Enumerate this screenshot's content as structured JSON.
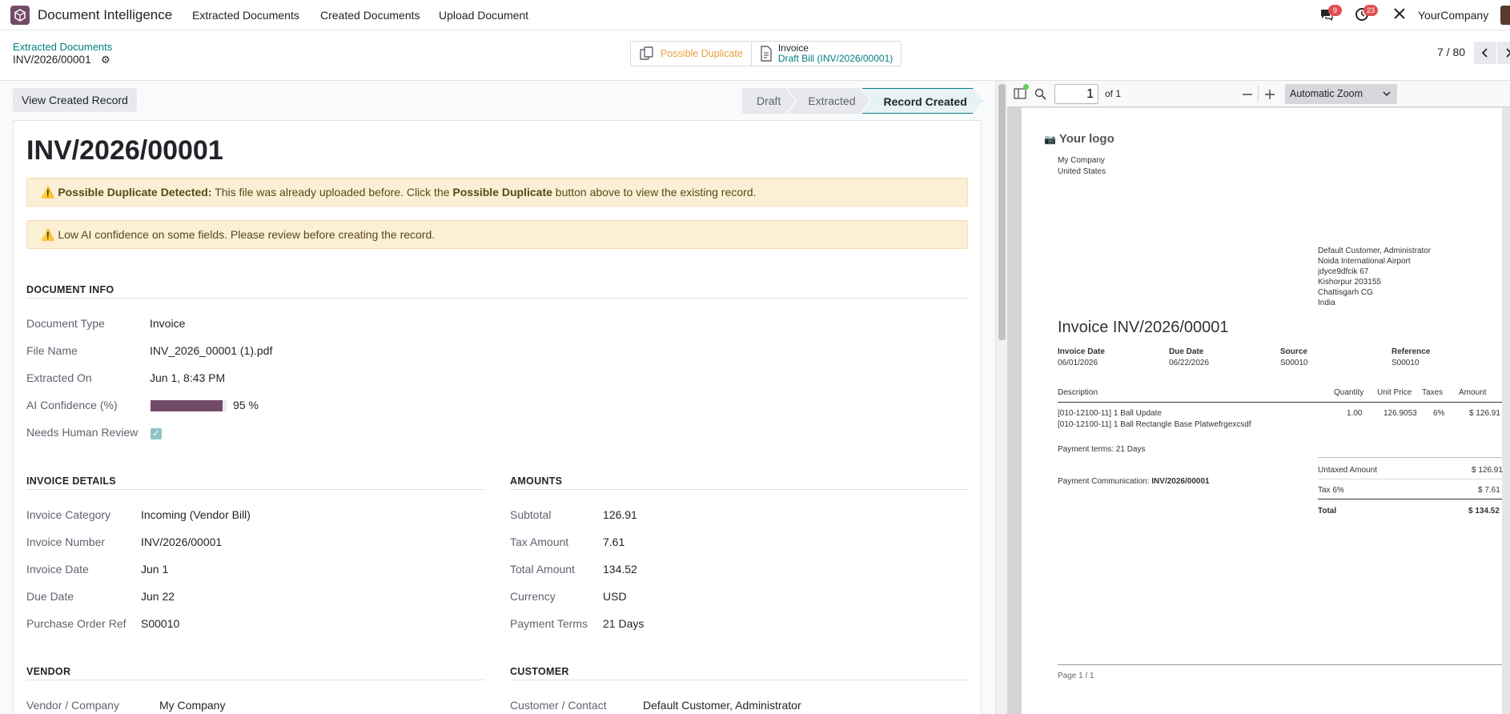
{
  "navbar": {
    "app_name": "Document Intelligence",
    "menu": [
      "Extracted Documents",
      "Created Documents",
      "Upload Document"
    ],
    "chat_badge": "9",
    "activity_badge": "23",
    "company": "YourCompany"
  },
  "control_panel": {
    "breadcrumb": "Extracted Documents",
    "record_name": "INV/2026/00001",
    "smart_dup": "Possible Duplicate",
    "smart_invoice_title": "Invoice",
    "smart_invoice_sub": "Draft Bill (INV/2026/00001)",
    "pager": "7 / 80"
  },
  "form": {
    "view_button": "View Created Record",
    "stages": [
      "Draft",
      "Extracted",
      "Record Created"
    ],
    "active_stage": "Record Created",
    "title": "INV/2026/00001",
    "alert1": {
      "prefix": "⚠️ ",
      "bold1": "Possible Duplicate Detected:",
      "mid": " This file was already uploaded before. Click the ",
      "bold2": "Possible Duplicate",
      "end": " button above to view the existing record."
    },
    "alert2": "⚠️ Low AI confidence on some fields. Please review before creating the record.",
    "document_info": {
      "title": "DOCUMENT INFO",
      "document_type_label": "Document Type",
      "document_type": "Invoice",
      "file_name_label": "File Name",
      "file_name": "INV_2026_00001 (1).pdf",
      "extracted_on_label": "Extracted On",
      "extracted_on": "Jun 1, 8:43 PM",
      "confidence_label": "AI Confidence (%)",
      "confidence": "95 %",
      "confidence_value": 95,
      "review_label": "Needs Human Review"
    },
    "invoice_details": {
      "title": "INVOICE DETAILS",
      "category_label": "Invoice Category",
      "category": "Incoming (Vendor Bill)",
      "number_label": "Invoice Number",
      "number": "INV/2026/00001",
      "date_label": "Invoice Date",
      "date": "Jun 1",
      "due_label": "Due Date",
      "due": "Jun 22",
      "po_label": "Purchase Order Ref",
      "po": "S00010"
    },
    "amounts": {
      "title": "AMOUNTS",
      "subtotal_label": "Subtotal",
      "subtotal": "126.91",
      "tax_label": "Tax Amount",
      "tax": "7.61",
      "total_label": "Total Amount",
      "total": "134.52",
      "currency_label": "Currency",
      "currency": "USD",
      "terms_label": "Payment Terms",
      "terms": "21 Days"
    },
    "vendor": {
      "title": "VENDOR",
      "company_label": "Vendor / Company",
      "company": "My Company"
    },
    "customer": {
      "title": "CUSTOMER",
      "contact_label": "Customer / Contact",
      "contact": "Default Customer, Administrator"
    }
  },
  "pdf": {
    "page_input": "1",
    "of": "of 1",
    "zoom": "Automatic Zoom",
    "logo": "Your logo",
    "company_lines": [
      "My Company",
      "United States"
    ],
    "customer_lines": [
      "Default Customer, Administrator",
      "Noida International Airport",
      "jdyce9dfcik 67",
      "Kishorpur 203155",
      "Chattisgarh CG",
      "India"
    ],
    "heading": "Invoice INV/2026/00001",
    "info_labels": [
      "Invoice Date",
      "Due Date",
      "Source",
      "Reference"
    ],
    "info_values": [
      "06/01/2026",
      "06/22/2026",
      "S00010",
      "S00010"
    ],
    "cols": [
      "Description",
      "Quantity",
      "Unit Price",
      "Taxes",
      "Amount"
    ],
    "line_desc1": "[010-12100-11] 1 Ball Update",
    "line_desc2": "[010-12100-11] 1 Ball Rectangle Base Platwefrgexcsdf",
    "line_qty": "1.00",
    "line_price": "126.9053",
    "line_tax": "6%",
    "line_amount": "$ 126.91",
    "payment_terms": "Payment terms: 21 Days",
    "payment_comm_label": "Payment Communication: ",
    "payment_comm": "INV/2026/00001",
    "untaxed_label": "Untaxed Amount",
    "untaxed": "$ 126.91",
    "tax_label": "Tax 6%",
    "tax": "$ 7.61",
    "total_label": "Total",
    "total": "$ 134.52",
    "footer": "Page 1 / 1"
  }
}
